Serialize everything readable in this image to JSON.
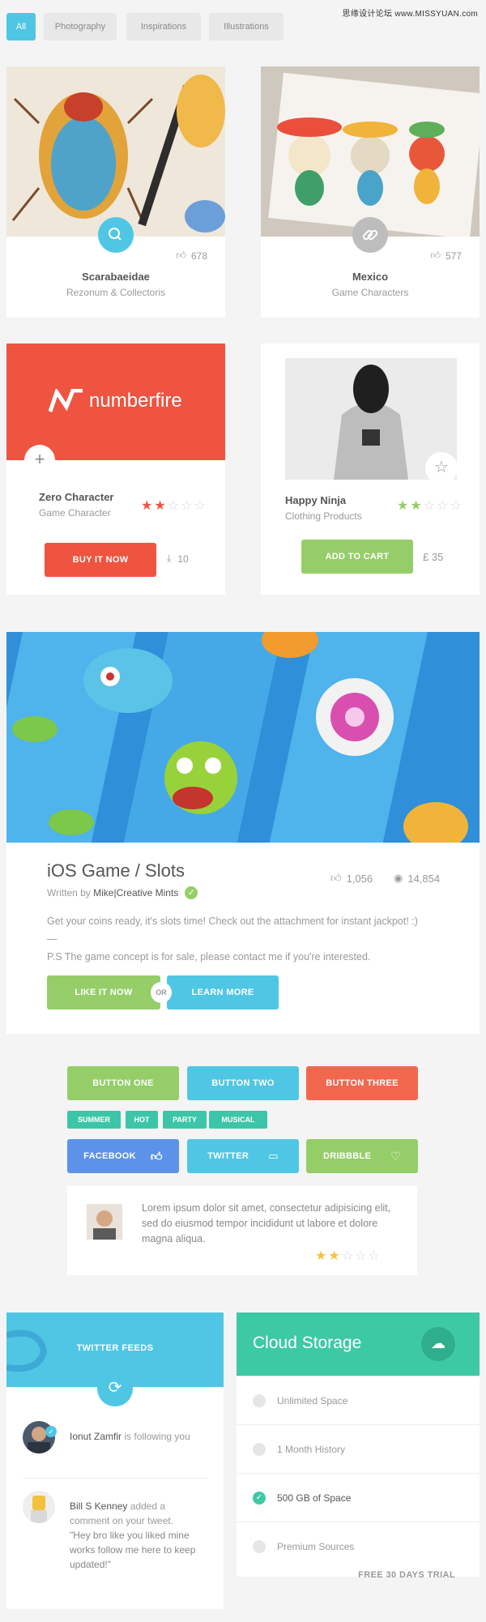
{
  "watermark": "思缘设计论坛 www.MISSYUAN.com",
  "tabs": [
    {
      "label": "All"
    },
    {
      "label": "Photography"
    },
    {
      "label": "Inspirations"
    },
    {
      "label": "Illustrations"
    }
  ],
  "gallery": [
    {
      "title": "Scarabaeidae",
      "subtitle": "Rezonum & Collectoris",
      "likes": "678",
      "badge": "search-icon"
    },
    {
      "title": "Mexico",
      "subtitle": "Game Characters",
      "likes": "577",
      "badge": "link-icon"
    }
  ],
  "numberfire": {
    "brand": "numberfire",
    "title": "Zero Character",
    "subtitle": "Game Character",
    "rating": "2 of 5",
    "button": "BUY IT NOW",
    "downloads": "10"
  },
  "ninja": {
    "title": "Happy Ninja",
    "subtitle": "Clothing Products",
    "rating": "2 of 5",
    "button": "ADD TO CART",
    "price": "£ 35"
  },
  "post": {
    "title": "iOS Game / Slots",
    "written_by": "Written by",
    "author": "Mike",
    "separator": "|",
    "company": "Creative Mints",
    "likes": "1,056",
    "views": "14,854",
    "text": "Get your coins ready, it's slots time! Check out the attachment for instant jackpot! :)",
    "divider": "—",
    "ps": "P.S The game concept is for sale, please contact me if you're interested.",
    "like_button": "LIKE IT NOW",
    "or": "OR",
    "learn_button": "LEARN MORE"
  },
  "buttons": {
    "one": "BUTTON ONE",
    "two": "BUTTON TWO",
    "three": "BUTTON THREE"
  },
  "tags": [
    "SUMMER",
    "HOT",
    "PARTY",
    "MUSICAL"
  ],
  "social": {
    "facebook": "FACEBOOK",
    "twitter": "TWITTER",
    "dribbble": "DRIBBBLE"
  },
  "review": {
    "text": "Lorem ipsum dolor sit amet, consectetur adipisicing elit, sed do eiusmod tempor incididunt ut labore et dolore magna aliqua.",
    "rating": "2 of 5"
  },
  "twitter_feeds": {
    "title": "TWITTER FEEDS",
    "items": [
      {
        "name": "Ionut Zamfir",
        "action": "is following you"
      },
      {
        "name": "Bill S Kenney",
        "action": "added a comment on your tweet.",
        "quote": "\"Hey bro like you liked mine works follow me here to keep updated!\""
      }
    ]
  },
  "cloud": {
    "title": "Cloud Storage",
    "features": [
      {
        "label": "Unlimited Space",
        "checked": false
      },
      {
        "label": "1 Month History",
        "checked": false
      },
      {
        "label": "500 GB of Space",
        "checked": true
      },
      {
        "label": "Premium Sources",
        "checked": false
      }
    ],
    "trial": "FREE 30 DAYS TRIAL"
  },
  "colors": {
    "cyan": "#4fc7e4",
    "red": "#ee5440",
    "green": "#95ce68",
    "teal": "#3cc6a7",
    "blue": "#5c93e8"
  }
}
